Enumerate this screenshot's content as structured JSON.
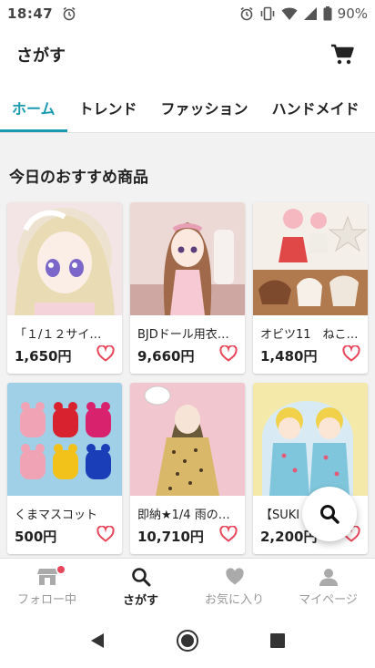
{
  "status_bar": {
    "time": "18:47",
    "battery": "90%"
  },
  "app_bar": {
    "title": "さがす"
  },
  "tabs": [
    {
      "label": "ホーム",
      "active": true
    },
    {
      "label": "トレンド",
      "active": false
    },
    {
      "label": "ファッション",
      "active": false
    },
    {
      "label": "ハンドメイド",
      "active": false
    }
  ],
  "section": {
    "title": "今日のおすすめ商品"
  },
  "products": [
    {
      "name": "「１/１２サイ…",
      "price": "1,650円"
    },
    {
      "name": "BJDドール用衣…",
      "price": "9,660円"
    },
    {
      "name": "オビツ11　ねこ…",
      "price": "1,480円"
    },
    {
      "name": "くまマスコット",
      "price": "500円"
    },
    {
      "name": "即納★1/4 雨の…",
      "price": "10,710円"
    },
    {
      "name": "【SUKI",
      "price": "2,200円"
    }
  ],
  "bottom_nav": [
    {
      "label": "フォロー中",
      "icon": "store-icon",
      "active": false
    },
    {
      "label": "さがす",
      "icon": "search-icon",
      "active": true
    },
    {
      "label": "お気に入り",
      "icon": "heart-icon",
      "active": false
    },
    {
      "label": "マイページ",
      "icon": "person-icon",
      "active": false
    }
  ],
  "colors": {
    "accent": "#1a9ab0",
    "heart": "#e8465a"
  }
}
